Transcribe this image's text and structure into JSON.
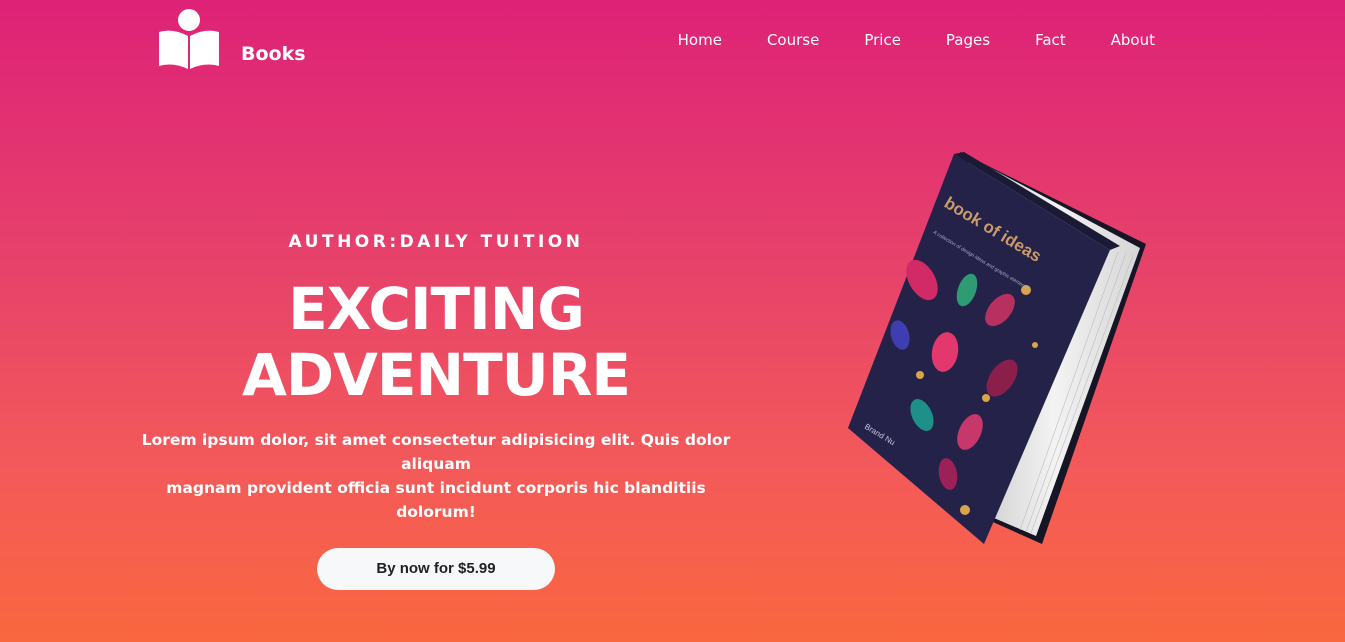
{
  "brand": {
    "name": "Books",
    "icon": "book-reader-icon"
  },
  "nav": {
    "items": [
      "Home",
      "Course",
      "Price",
      "Pages",
      "Fact",
      "About"
    ]
  },
  "hero": {
    "author": "AUTHOR:DAILY TUITION",
    "headline_line1": "EXCITING",
    "headline_line2": "ADVENTURE",
    "description_line1": "Lorem ipsum dolor, sit amet consectetur adipisicing elit. Quis dolor aliquam",
    "description_line2": "magnam provident officia sunt incidunt corporis hic blanditiis dolorum!",
    "cta_label": "By now for $5.99"
  },
  "book": {
    "title": "book of ideas",
    "subtitle": "A collection of design ideas and graphic elements",
    "author": "Brand Nu"
  },
  "colors": {
    "gradient_top": "#de2277",
    "gradient_bottom": "#f9673e",
    "button_bg": "#f6f8fa",
    "book_cover": "#25224a"
  }
}
